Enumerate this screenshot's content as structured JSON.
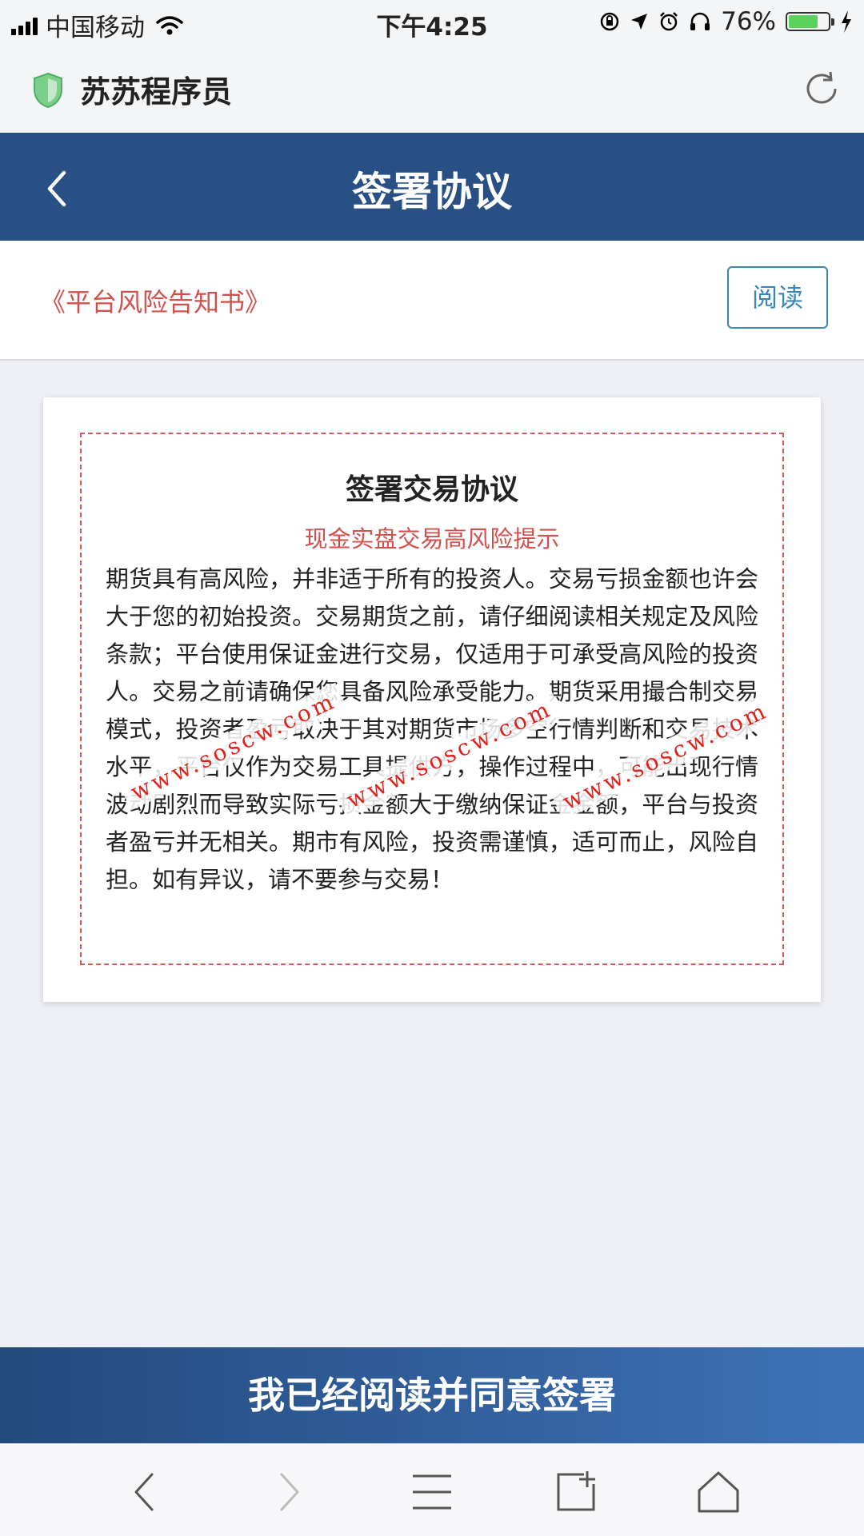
{
  "status_bar": {
    "carrier": "中国移动",
    "time": "下午4:25",
    "battery_percent_text": "76%",
    "battery_level": 0.76
  },
  "browser": {
    "site_title": "苏苏程序员"
  },
  "header": {
    "title": "签署协议"
  },
  "notice": {
    "link_text": "《平台风险告知书》",
    "read_button": "阅读"
  },
  "agreement": {
    "title": "签署交易协议",
    "subtitle": "现金实盘交易高风险提示",
    "body": "期货具有高风险，并非适于所有的投资人。交易亏损金额也许会大于您的初始投资。交易期货之前，请仔细阅读相关规定及风险条款；平台使用保证金进行交易，仅适用于可承受高风险的投资人。交易之前请确保您具备风险承受能力。期货采用撮合制交易模式，投资者盈亏取决于其对期货市场多空行情判断和交易技术水平，平台仅作为交易工具提供方，操作过程中，可能出现行情波动剧烈而导致实际亏损金额大于缴纳保证金金额，平台与投资者盈亏并无相关。期市有风险，投资需谨慎，适可而止，风险自担。如有异议，请不要参与交易！",
    "watermarks": [
      "www.soscw.com",
      "www.soscw.com",
      "www.soscw.com"
    ]
  },
  "actions": {
    "agree_button": "我已经阅读并同意签署"
  },
  "colors": {
    "header_bg": "#285085",
    "accent_red": "#d0504c",
    "button_blue": "#3a86b8",
    "agree_gradient_start": "#234a7d",
    "agree_gradient_end": "#3e72b8"
  },
  "icons": {
    "shield": "shield-icon",
    "refresh": "refresh-icon",
    "back": "chevron-left-icon",
    "toolbar": [
      "back-arrow-icon",
      "forward-arrow-icon",
      "menu-icon",
      "tabs-icon",
      "home-icon"
    ]
  }
}
